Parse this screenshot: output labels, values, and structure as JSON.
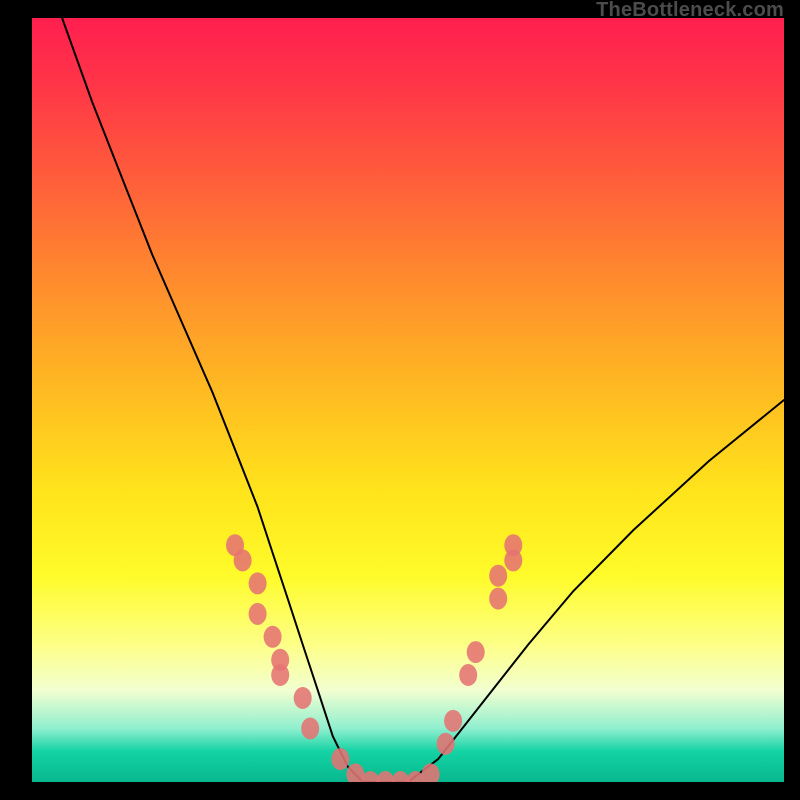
{
  "watermark": "TheBottleneck.com",
  "chart_data": {
    "type": "line",
    "title": "",
    "xlabel": "",
    "ylabel": "",
    "xlim": [
      0,
      100
    ],
    "ylim": [
      0,
      100
    ],
    "grid": false,
    "legend": false,
    "series": [
      {
        "name": "bottleneck-curve",
        "x": [
          4,
          8,
          12,
          16,
          20,
          24,
          28,
          30,
          32,
          34,
          36,
          38,
          40,
          42,
          44,
          46,
          48,
          50,
          54,
          58,
          62,
          66,
          72,
          80,
          90,
          100
        ],
        "values": [
          100,
          89,
          79,
          69,
          60,
          51,
          41,
          36,
          30,
          24,
          18,
          12,
          6,
          2,
          0,
          0,
          0,
          0,
          3,
          8,
          13,
          18,
          25,
          33,
          42,
          50
        ]
      }
    ],
    "markers": [
      {
        "x": 27,
        "y": 31
      },
      {
        "x": 28,
        "y": 29
      },
      {
        "x": 30,
        "y": 26
      },
      {
        "x": 30,
        "y": 22
      },
      {
        "x": 32,
        "y": 19
      },
      {
        "x": 33,
        "y": 16
      },
      {
        "x": 33,
        "y": 14
      },
      {
        "x": 36,
        "y": 11
      },
      {
        "x": 37,
        "y": 7
      },
      {
        "x": 41,
        "y": 3
      },
      {
        "x": 43,
        "y": 1
      },
      {
        "x": 45,
        "y": 0
      },
      {
        "x": 47,
        "y": 0
      },
      {
        "x": 49,
        "y": 0
      },
      {
        "x": 51,
        "y": 0
      },
      {
        "x": 53,
        "y": 1
      },
      {
        "x": 55,
        "y": 5
      },
      {
        "x": 56,
        "y": 8
      },
      {
        "x": 58,
        "y": 14
      },
      {
        "x": 59,
        "y": 17
      },
      {
        "x": 62,
        "y": 24
      },
      {
        "x": 62,
        "y": 27
      },
      {
        "x": 64,
        "y": 29
      },
      {
        "x": 64,
        "y": 31
      }
    ],
    "colors": {
      "curve": "#000000",
      "marker": "#e57373"
    }
  }
}
